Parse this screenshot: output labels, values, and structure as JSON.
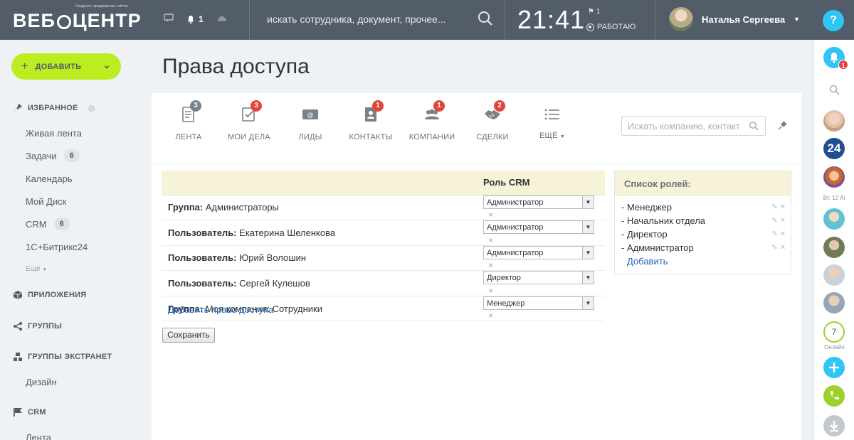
{
  "header": {
    "logo_text": "ВЕБЦЕНТР",
    "logo_left": "ВЕБ",
    "logo_right": "ЦЕНТР",
    "logo_sub": "Создание, продвижение сайтов",
    "notifications_count": "1",
    "search_placeholder": "искать сотрудника, документ, прочее...",
    "clock": "21:41",
    "flag_count": "1",
    "work_status": "РАБОТАЮ",
    "user_name": "Наталья Сергеева",
    "help_label": "?"
  },
  "sidebar": {
    "add_button": "ДОБАВИТЬ",
    "sections": {
      "favorites": "ИЗБРАННОЕ",
      "apps": "ПРИЛОЖЕНИЯ",
      "groups": "ГРУППЫ",
      "extranet": "ГРУППЫ ЭКСТРАНЕТ",
      "crm": "CRM"
    },
    "items": [
      {
        "label": "Живая лента"
      },
      {
        "label": "Задачи",
        "badge": "6"
      },
      {
        "label": "Календарь"
      },
      {
        "label": "Мой Диск"
      },
      {
        "label": "CRM",
        "badge": "6"
      },
      {
        "label": "1С+Битрикс24"
      }
    ],
    "more_label": "Ещё",
    "extranet_items": [
      {
        "label": "Дизайн"
      }
    ],
    "crm_items": [
      {
        "label": "Лента"
      }
    ]
  },
  "rightbar": {
    "notif_badge": "1",
    "date_label": "Вт, 12 Ar",
    "online_count": "7",
    "online_label": "Онлайн",
    "count_label": "24"
  },
  "page": {
    "title": "Права доступа"
  },
  "crm_tabs": [
    {
      "label": "ЛЕНТА",
      "badge": "3",
      "badge_color": "#7a8289",
      "icon": "feed-icon"
    },
    {
      "label": "МОИ ДЕЛА",
      "badge": "3",
      "badge_color": "#e2443b",
      "icon": "tasks-icon"
    },
    {
      "label": "ЛИДЫ",
      "badge": "",
      "icon": "leads-icon"
    },
    {
      "label": "КОНТАКТЫ",
      "badge": "1",
      "badge_color": "#e2443b",
      "icon": "contacts-icon"
    },
    {
      "label": "КОМПАНИИ",
      "badge": "1",
      "badge_color": "#e2443b",
      "icon": "companies-icon"
    },
    {
      "label": "СДЕЛКИ",
      "badge": "2",
      "badge_color": "#e2443b",
      "icon": "deals-icon"
    },
    {
      "label": "ЕЩЁ",
      "badge": "",
      "icon": "more-icon"
    }
  ],
  "crm_search_placeholder": "Искать компанию, контакт",
  "access": {
    "column_header": "Роль CRM",
    "rows": [
      {
        "type": "Группа:",
        "name": "Администраторы",
        "role": "Администратор"
      },
      {
        "type": "Пользователь:",
        "name": "Екатерина Шеленкова",
        "role": "Администратор"
      },
      {
        "type": "Пользователь:",
        "name": "Юрий Волошин",
        "role": "Администратор"
      },
      {
        "type": "Пользователь:",
        "name": "Сергей Кулешов",
        "role": "Директор"
      },
      {
        "type": "Группа:",
        "name": "Моя компания: Сотрудники",
        "role": "Менеджер"
      }
    ],
    "add_link": "Добавить право доступа",
    "save_button": "Сохранить"
  },
  "roles": {
    "title": "Список ролей:",
    "items": [
      "- Менеджер",
      "- Начальник отдела",
      "- Директор",
      "- Администратор"
    ],
    "add_link": "Добавить"
  },
  "colors": {
    "topbar": "#535c69",
    "add_button": "#bbed21",
    "accent_blue": "#2fc6f6",
    "badge_red": "#e2443b",
    "link": "#2067b0",
    "table_head": "#f6f3d8"
  }
}
